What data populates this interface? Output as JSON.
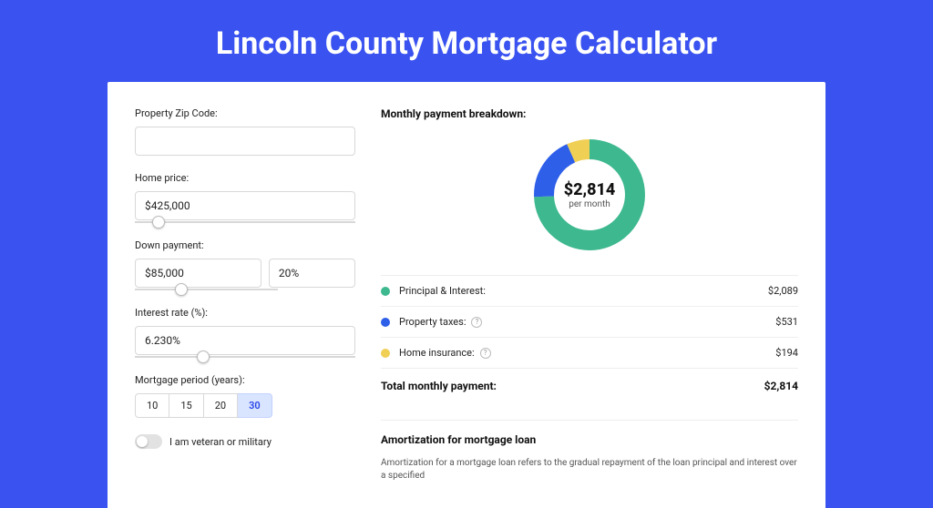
{
  "title": "Lincoln County Mortgage Calculator",
  "form": {
    "zip_label": "Property Zip Code:",
    "zip_value": "",
    "home_price_label": "Home price:",
    "home_price_value": "$425,000",
    "down_payment_label": "Down payment:",
    "down_payment_value": "$85,000",
    "down_payment_pct": "20%",
    "interest_label": "Interest rate (%):",
    "interest_value": "6.230%",
    "period_label": "Mortgage period (years):",
    "periods": [
      "10",
      "15",
      "20",
      "30"
    ],
    "period_selected": "30",
    "veteran_label": "I am veteran or military"
  },
  "breakdown": {
    "title": "Monthly payment breakdown:",
    "center_amount": "$2,814",
    "center_sub": "per month",
    "rows": [
      {
        "label": "Principal & Interest:",
        "value": "$2,089"
      },
      {
        "label": "Property taxes:",
        "value": "$531"
      },
      {
        "label": "Home insurance:",
        "value": "$194"
      }
    ],
    "total_label": "Total monthly payment:",
    "total_value": "$2,814"
  },
  "amort": {
    "title": "Amortization for mortgage loan",
    "text": "Amortization for a mortgage loan refers to the gradual repayment of the loan principal and interest over a specified"
  },
  "chart_data": {
    "type": "pie",
    "title": "Monthly payment breakdown",
    "series": [
      {
        "name": "Principal & Interest",
        "value": 2089,
        "color": "#3db88f"
      },
      {
        "name": "Property taxes",
        "value": 531,
        "color": "#2e5fe8"
      },
      {
        "name": "Home insurance",
        "value": 194,
        "color": "#f0cf55"
      }
    ],
    "total": 2814
  }
}
